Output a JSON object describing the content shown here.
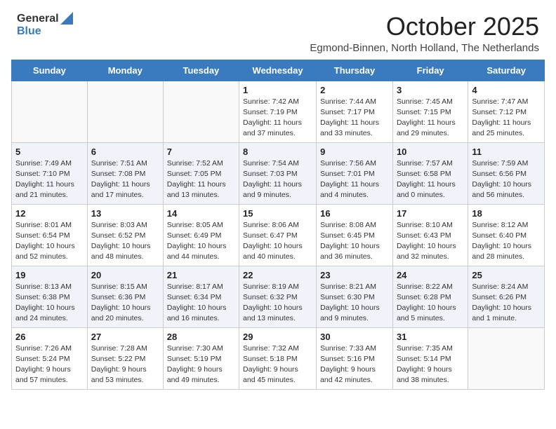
{
  "header": {
    "logo_general": "General",
    "logo_blue": "Blue",
    "month_title": "October 2025",
    "subtitle": "Egmond-Binnen, North Holland, The Netherlands"
  },
  "days_of_week": [
    "Sunday",
    "Monday",
    "Tuesday",
    "Wednesday",
    "Thursday",
    "Friday",
    "Saturday"
  ],
  "weeks": [
    [
      {
        "day": "",
        "info": ""
      },
      {
        "day": "",
        "info": ""
      },
      {
        "day": "",
        "info": ""
      },
      {
        "day": "1",
        "info": "Sunrise: 7:42 AM\nSunset: 7:19 PM\nDaylight: 11 hours and 37 minutes."
      },
      {
        "day": "2",
        "info": "Sunrise: 7:44 AM\nSunset: 7:17 PM\nDaylight: 11 hours and 33 minutes."
      },
      {
        "day": "3",
        "info": "Sunrise: 7:45 AM\nSunset: 7:15 PM\nDaylight: 11 hours and 29 minutes."
      },
      {
        "day": "4",
        "info": "Sunrise: 7:47 AM\nSunset: 7:12 PM\nDaylight: 11 hours and 25 minutes."
      }
    ],
    [
      {
        "day": "5",
        "info": "Sunrise: 7:49 AM\nSunset: 7:10 PM\nDaylight: 11 hours and 21 minutes."
      },
      {
        "day": "6",
        "info": "Sunrise: 7:51 AM\nSunset: 7:08 PM\nDaylight: 11 hours and 17 minutes."
      },
      {
        "day": "7",
        "info": "Sunrise: 7:52 AM\nSunset: 7:05 PM\nDaylight: 11 hours and 13 minutes."
      },
      {
        "day": "8",
        "info": "Sunrise: 7:54 AM\nSunset: 7:03 PM\nDaylight: 11 hours and 9 minutes."
      },
      {
        "day": "9",
        "info": "Sunrise: 7:56 AM\nSunset: 7:01 PM\nDaylight: 11 hours and 4 minutes."
      },
      {
        "day": "10",
        "info": "Sunrise: 7:57 AM\nSunset: 6:58 PM\nDaylight: 11 hours and 0 minutes."
      },
      {
        "day": "11",
        "info": "Sunrise: 7:59 AM\nSunset: 6:56 PM\nDaylight: 10 hours and 56 minutes."
      }
    ],
    [
      {
        "day": "12",
        "info": "Sunrise: 8:01 AM\nSunset: 6:54 PM\nDaylight: 10 hours and 52 minutes."
      },
      {
        "day": "13",
        "info": "Sunrise: 8:03 AM\nSunset: 6:52 PM\nDaylight: 10 hours and 48 minutes."
      },
      {
        "day": "14",
        "info": "Sunrise: 8:05 AM\nSunset: 6:49 PM\nDaylight: 10 hours and 44 minutes."
      },
      {
        "day": "15",
        "info": "Sunrise: 8:06 AM\nSunset: 6:47 PM\nDaylight: 10 hours and 40 minutes."
      },
      {
        "day": "16",
        "info": "Sunrise: 8:08 AM\nSunset: 6:45 PM\nDaylight: 10 hours and 36 minutes."
      },
      {
        "day": "17",
        "info": "Sunrise: 8:10 AM\nSunset: 6:43 PM\nDaylight: 10 hours and 32 minutes."
      },
      {
        "day": "18",
        "info": "Sunrise: 8:12 AM\nSunset: 6:40 PM\nDaylight: 10 hours and 28 minutes."
      }
    ],
    [
      {
        "day": "19",
        "info": "Sunrise: 8:13 AM\nSunset: 6:38 PM\nDaylight: 10 hours and 24 minutes."
      },
      {
        "day": "20",
        "info": "Sunrise: 8:15 AM\nSunset: 6:36 PM\nDaylight: 10 hours and 20 minutes."
      },
      {
        "day": "21",
        "info": "Sunrise: 8:17 AM\nSunset: 6:34 PM\nDaylight: 10 hours and 16 minutes."
      },
      {
        "day": "22",
        "info": "Sunrise: 8:19 AM\nSunset: 6:32 PM\nDaylight: 10 hours and 13 minutes."
      },
      {
        "day": "23",
        "info": "Sunrise: 8:21 AM\nSunset: 6:30 PM\nDaylight: 10 hours and 9 minutes."
      },
      {
        "day": "24",
        "info": "Sunrise: 8:22 AM\nSunset: 6:28 PM\nDaylight: 10 hours and 5 minutes."
      },
      {
        "day": "25",
        "info": "Sunrise: 8:24 AM\nSunset: 6:26 PM\nDaylight: 10 hours and 1 minute."
      }
    ],
    [
      {
        "day": "26",
        "info": "Sunrise: 7:26 AM\nSunset: 5:24 PM\nDaylight: 9 hours and 57 minutes."
      },
      {
        "day": "27",
        "info": "Sunrise: 7:28 AM\nSunset: 5:22 PM\nDaylight: 9 hours and 53 minutes."
      },
      {
        "day": "28",
        "info": "Sunrise: 7:30 AM\nSunset: 5:19 PM\nDaylight: 9 hours and 49 minutes."
      },
      {
        "day": "29",
        "info": "Sunrise: 7:32 AM\nSunset: 5:18 PM\nDaylight: 9 hours and 45 minutes."
      },
      {
        "day": "30",
        "info": "Sunrise: 7:33 AM\nSunset: 5:16 PM\nDaylight: 9 hours and 42 minutes."
      },
      {
        "day": "31",
        "info": "Sunrise: 7:35 AM\nSunset: 5:14 PM\nDaylight: 9 hours and 38 minutes."
      },
      {
        "day": "",
        "info": ""
      }
    ]
  ]
}
